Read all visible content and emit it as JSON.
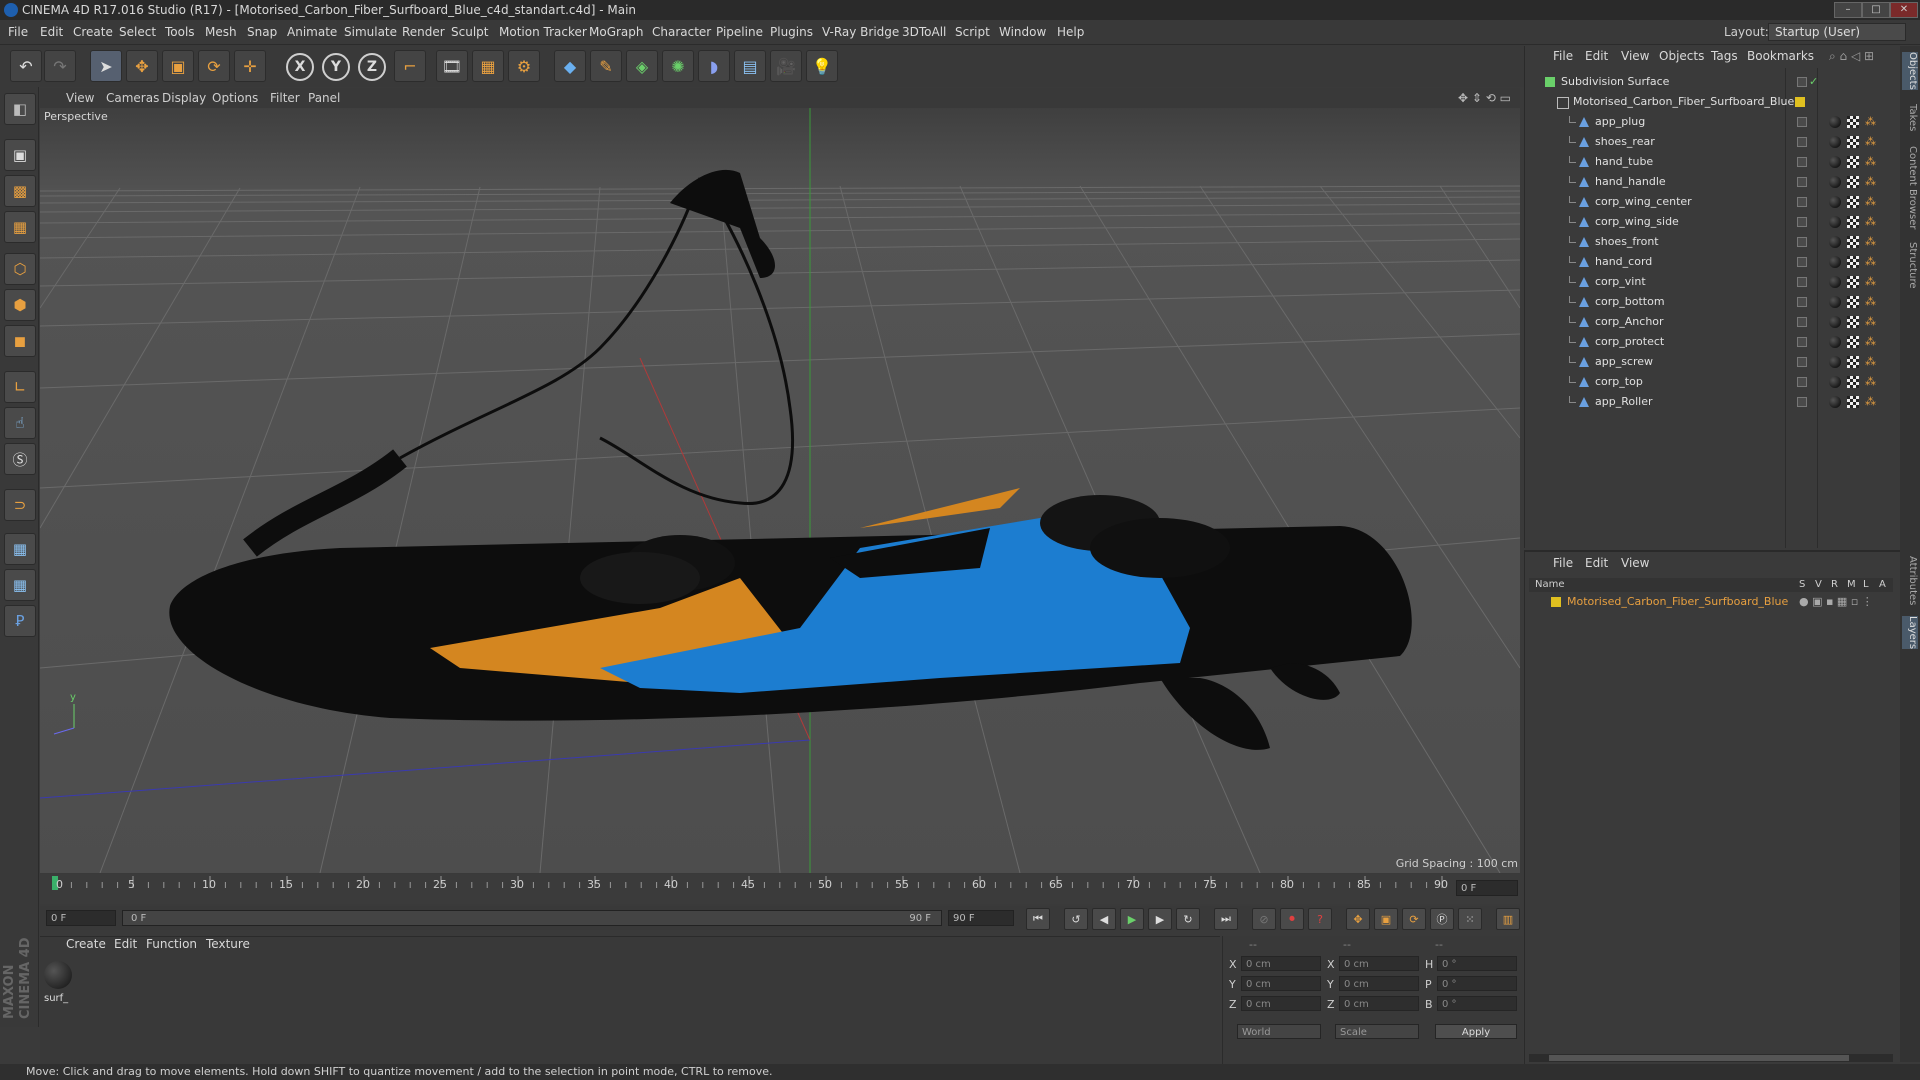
{
  "window": {
    "title": "CINEMA 4D R17.016 Studio (R17) - [Motorised_Carbon_Fiber_Surfboard_Blue_c4d_standart.c4d] - Main",
    "btn_min": "–",
    "btn_max": "□",
    "btn_close": "✕"
  },
  "menubar": {
    "items": [
      "File",
      "Edit",
      "Create",
      "Select",
      "Tools",
      "Mesh",
      "Snap",
      "Animate",
      "Simulate",
      "Render",
      "Sculpt",
      "Motion Tracker",
      "MoGraph",
      "Character",
      "Pipeline",
      "Plugins",
      "V-Ray Bridge",
      "3DToAll",
      "Script",
      "Window",
      "Help"
    ],
    "layout_label": "Layout:",
    "layout_value": "Startup (User)"
  },
  "toolbar": {
    "icons": [
      "undo-icon",
      "redo-icon",
      "select-arrow-icon",
      "move-icon",
      "scale-icon",
      "rotate-icon",
      "transform-icon",
      "x-axis-icon",
      "y-axis-icon",
      "z-axis-icon",
      "world-coord-icon",
      "render-view-icon",
      "render-region-icon",
      "render-settings-icon",
      "cube-icon",
      "pen-icon",
      "subdivision-icon",
      "array-icon",
      "deformer-icon",
      "floor-icon",
      "camera-icon",
      "light-icon"
    ],
    "axis_x": "X",
    "axis_y": "Y",
    "axis_z": "Z"
  },
  "viewport": {
    "menu": [
      "View",
      "Cameras",
      "Display",
      "Options",
      "Filter",
      "Panel"
    ],
    "label": "Perspective",
    "grid_spacing": "Grid Spacing : 100 cm"
  },
  "timeline": {
    "ticks": [
      "0",
      "5",
      "10",
      "15",
      "20",
      "25",
      "30",
      "35",
      "40",
      "45",
      "50",
      "55",
      "60",
      "65",
      "70",
      "75",
      "80",
      "85",
      "90"
    ],
    "current_frame": "0 F",
    "start_frame": "0 F",
    "slider_start": "0 F",
    "slider_end": "90 F",
    "end_frame": "90 F"
  },
  "material_panel": {
    "menu": [
      "Create",
      "Edit",
      "Function",
      "Texture"
    ],
    "material_name": "surf_"
  },
  "coord_panel": {
    "headers": [
      "--",
      "--",
      "--"
    ],
    "rows": [
      {
        "a": "X",
        "av": "0 cm",
        "b": "X",
        "bv": "0 cm",
        "c": "H",
        "cv": "0 °"
      },
      {
        "a": "Y",
        "av": "0 cm",
        "b": "Y",
        "bv": "0 cm",
        "c": "P",
        "cv": "0 °"
      },
      {
        "a": "Z",
        "av": "0 cm",
        "b": "Z",
        "bv": "0 cm",
        "c": "B",
        "cv": "0 °"
      }
    ],
    "world": "World",
    "scale": "Scale",
    "apply": "Apply"
  },
  "objects_panel": {
    "menu": [
      "File",
      "Edit",
      "View",
      "Objects",
      "Tags",
      "Bookmarks"
    ],
    "root": "Subdivision Surface",
    "group": "Motorised_Carbon_Fiber_Surfboard_Blue",
    "children": [
      "app_plug",
      "shoes_rear",
      "hand_tube",
      "hand_handle",
      "corp_wing_center",
      "corp_wing_side",
      "shoes_front",
      "hand_cord",
      "corp_vint",
      "corp_bottom",
      "corp_Anchor",
      "corp_protect",
      "app_screw",
      "corp_top",
      "app_Roller"
    ]
  },
  "layers_panel": {
    "menu": [
      "File",
      "Edit",
      "View"
    ],
    "col_name": "Name",
    "cols": [
      "S",
      "V",
      "R",
      "M",
      "L",
      "A"
    ],
    "layer": "Motorised_Carbon_Fiber_Surfboard_Blue",
    "layer_color": "#e0c020"
  },
  "right_tabs": [
    "Objects",
    "Takes",
    "Content Browser",
    "Structure",
    "Attributes",
    "Layers"
  ],
  "status": "Move: Click and drag to move elements. Hold down SHIFT to quantize movement / add to the selection in point mode, CTRL to remove.",
  "maxon": "MAXON CINEMA 4D",
  "colors": {
    "accent_orange": "#e89a30",
    "board_blue": "#1e7fd0",
    "layer_yellow": "#e0c020"
  }
}
